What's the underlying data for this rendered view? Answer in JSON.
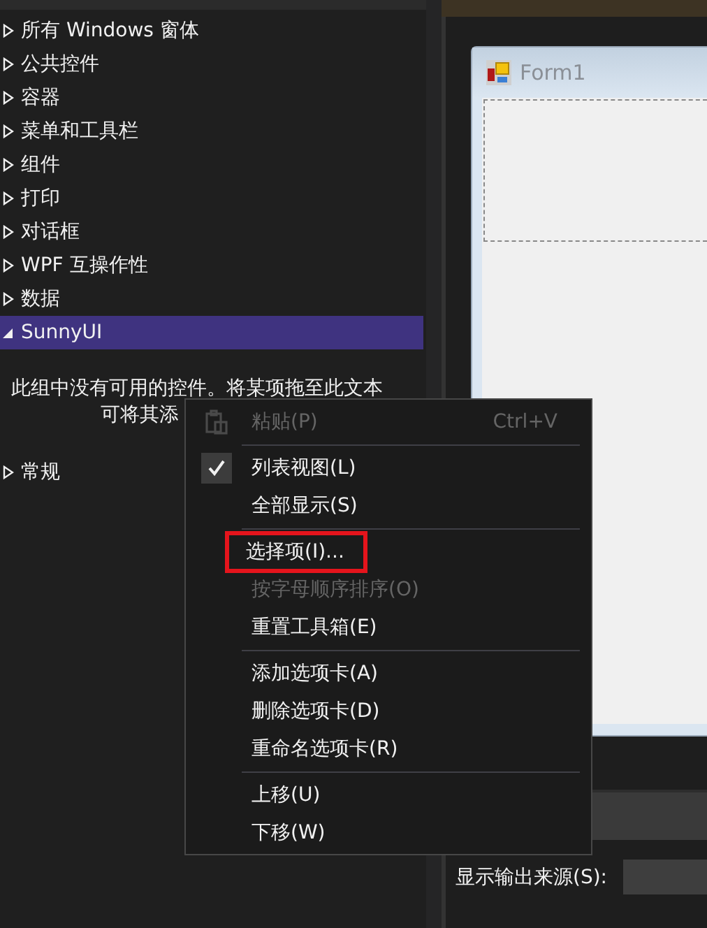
{
  "toolbox": {
    "groups": [
      {
        "label": "所有 Windows 窗体",
        "expanded": false,
        "selected": false
      },
      {
        "label": "公共控件",
        "expanded": false,
        "selected": false
      },
      {
        "label": "容器",
        "expanded": false,
        "selected": false
      },
      {
        "label": "菜单和工具栏",
        "expanded": false,
        "selected": false
      },
      {
        "label": "组件",
        "expanded": false,
        "selected": false
      },
      {
        "label": "打印",
        "expanded": false,
        "selected": false
      },
      {
        "label": "对话框",
        "expanded": false,
        "selected": false
      },
      {
        "label": "WPF 互操作性",
        "expanded": false,
        "selected": false
      },
      {
        "label": "数据",
        "expanded": false,
        "selected": false
      },
      {
        "label": "SunnyUI",
        "expanded": true,
        "selected": true,
        "message_lines": [
          "此组中没有可用的控件。将某项拖至此文本",
          "可将其添"
        ]
      },
      {
        "label": "常规",
        "expanded": false,
        "selected": false
      }
    ]
  },
  "designer": {
    "form_title": "Form1",
    "output_label": "显示输出来源(S):"
  },
  "context_menu": [
    {
      "kind": "paste",
      "label": "粘贴(P)",
      "shortcut": "Ctrl+V",
      "disabled": true,
      "checked": false,
      "highlighted": false
    },
    {
      "kind": "separator"
    },
    {
      "kind": "command",
      "label": "列表视图(L)",
      "disabled": false,
      "checked": true,
      "highlighted": false
    },
    {
      "kind": "command",
      "label": "全部显示(S)",
      "disabled": false,
      "checked": false,
      "highlighted": false
    },
    {
      "kind": "separator"
    },
    {
      "kind": "command",
      "label": "选择项(I)...",
      "disabled": false,
      "checked": false,
      "highlighted": true
    },
    {
      "kind": "command",
      "label": "按字母顺序排序(O)",
      "disabled": true,
      "checked": false,
      "highlighted": false
    },
    {
      "kind": "command",
      "label": "重置工具箱(E)",
      "disabled": false,
      "checked": false,
      "highlighted": false
    },
    {
      "kind": "separator"
    },
    {
      "kind": "command",
      "label": "添加选项卡(A)",
      "disabled": false,
      "checked": false,
      "highlighted": false
    },
    {
      "kind": "command",
      "label": "删除选项卡(D)",
      "disabled": false,
      "checked": false,
      "highlighted": false
    },
    {
      "kind": "command",
      "label": "重命名选项卡(R)",
      "disabled": false,
      "checked": false,
      "highlighted": false
    },
    {
      "kind": "separator"
    },
    {
      "kind": "command",
      "label": "上移(U)",
      "disabled": false,
      "checked": false,
      "highlighted": false
    },
    {
      "kind": "command",
      "label": "下移(W)",
      "disabled": false,
      "checked": false,
      "highlighted": false
    }
  ]
}
